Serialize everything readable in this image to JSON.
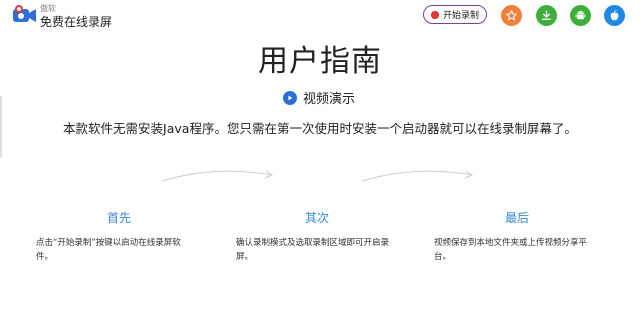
{
  "brand": {
    "small": "傲软",
    "name": "免费在线录屏"
  },
  "header": {
    "record_button": "开始录制",
    "icons": [
      "star-icon",
      "download-icon",
      "android-icon",
      "apple-icon"
    ],
    "icon_colors": [
      "#f0803c",
      "#3fae3a",
      "#3fae3a",
      "#1e88e5"
    ]
  },
  "hero": {
    "title": "用户指南",
    "demo_label": "视频演示",
    "description": "本款软件无需安装Java程序。您只需在第一次使用时安装一个启动器就可以在线录制屏幕了。"
  },
  "steps": [
    {
      "title": "首先",
      "text": "点击“开始录制”按键以启动在线录屏软件。"
    },
    {
      "title": "其次",
      "text": "确认录制模式及选取录制区域即可开启录屏。"
    },
    {
      "title": "最后",
      "text": "视频保存到本地文件夹或上传视频分享平台。"
    }
  ],
  "colors": {
    "accent": "#3b8ad9",
    "record_border": "#7b3fa0",
    "play": "#2d6fd6"
  }
}
